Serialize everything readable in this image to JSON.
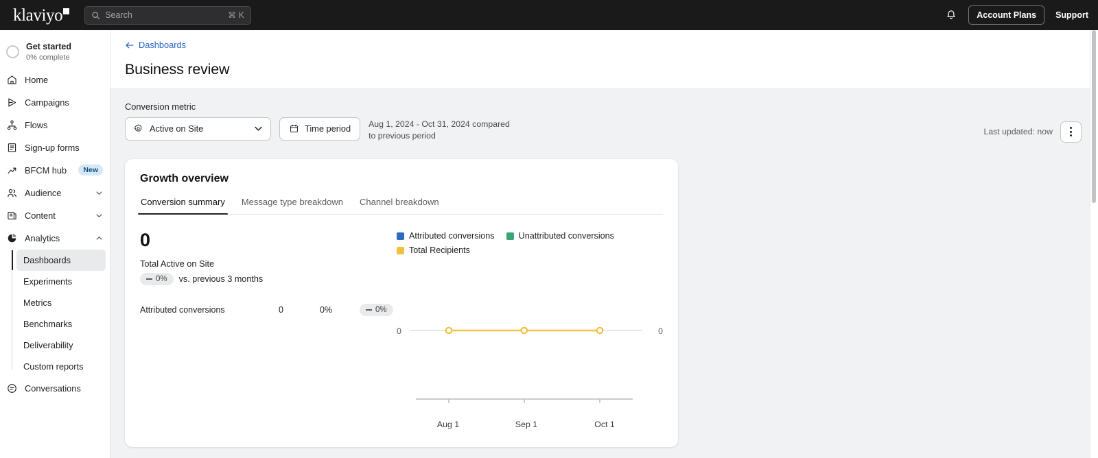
{
  "topbar": {
    "logo_text": "klaviyo",
    "search_placeholder": "Search",
    "search_shortcut": "⌘ K",
    "account_plans_label": "Account Plans",
    "support_label": "Support"
  },
  "sidebar": {
    "get_started": {
      "title": "Get started",
      "subtitle": "0% complete"
    },
    "items": [
      {
        "label": "Home",
        "icon": "home-icon"
      },
      {
        "label": "Campaigns",
        "icon": "campaigns-icon"
      },
      {
        "label": "Flows",
        "icon": "flows-icon"
      },
      {
        "label": "Sign-up forms",
        "icon": "signup-forms-icon"
      },
      {
        "label": "BFCM hub",
        "icon": "trending-up-icon",
        "badge": "New"
      },
      {
        "label": "Audience",
        "icon": "audience-icon",
        "expandable": true
      },
      {
        "label": "Content",
        "icon": "content-icon",
        "expandable": true
      },
      {
        "label": "Analytics",
        "icon": "analytics-icon",
        "expandable": true,
        "expanded": true
      }
    ],
    "analytics_subitems": [
      {
        "label": "Dashboards",
        "active": true
      },
      {
        "label": "Experiments",
        "active": false
      },
      {
        "label": "Metrics",
        "active": false
      },
      {
        "label": "Benchmarks",
        "active": false
      },
      {
        "label": "Deliverability",
        "active": false
      },
      {
        "label": "Custom reports",
        "active": false
      }
    ],
    "conversations": {
      "label": "Conversations",
      "icon": "conversations-icon"
    }
  },
  "page": {
    "back_link": "Dashboards",
    "title": "Business review"
  },
  "toolbar": {
    "conversion_metric_label": "Conversion metric",
    "metric_value": "Active on Site",
    "time_period_label": "Time period",
    "date_range": "Aug 1, 2024 - Oct 31, 2024 compared to previous period",
    "last_updated": "Last updated: now"
  },
  "card": {
    "title": "Growth overview",
    "tabs": [
      {
        "label": "Conversion summary",
        "active": true
      },
      {
        "label": "Message type breakdown",
        "active": false
      },
      {
        "label": "Channel breakdown",
        "active": false
      }
    ],
    "summary": {
      "big_value": "0",
      "big_label": "Total Active on Site",
      "delta_pill": "0%",
      "delta_text": "vs. previous 3 months"
    },
    "metric_rows": [
      {
        "name": "Attributed conversions",
        "value": "0",
        "percent": "0%",
        "delta": "0%"
      }
    ]
  },
  "chart_data": {
    "type": "line",
    "title": "",
    "x": [
      "Aug 1",
      "Sep 1",
      "Oct 1"
    ],
    "series": [
      {
        "name": "Attributed conversions",
        "color": "#2c6ebd",
        "values": [
          0,
          0,
          0
        ]
      },
      {
        "name": "Unattributed conversions",
        "color": "#3aa678",
        "values": [
          0,
          0,
          0
        ]
      },
      {
        "name": "Total Recipients",
        "color": "#f0c040",
        "values": [
          0,
          0,
          0
        ]
      }
    ],
    "y_left_label": "0",
    "y_right_label": "0",
    "ylim": [
      0,
      0
    ],
    "grid": true,
    "legend_position": "top"
  },
  "colors": {
    "attributed": "#2c6ebd",
    "unattributed": "#3aa678",
    "recipients": "#f0c040",
    "link": "#2663c4",
    "badge_bg": "#d4e8f7"
  }
}
